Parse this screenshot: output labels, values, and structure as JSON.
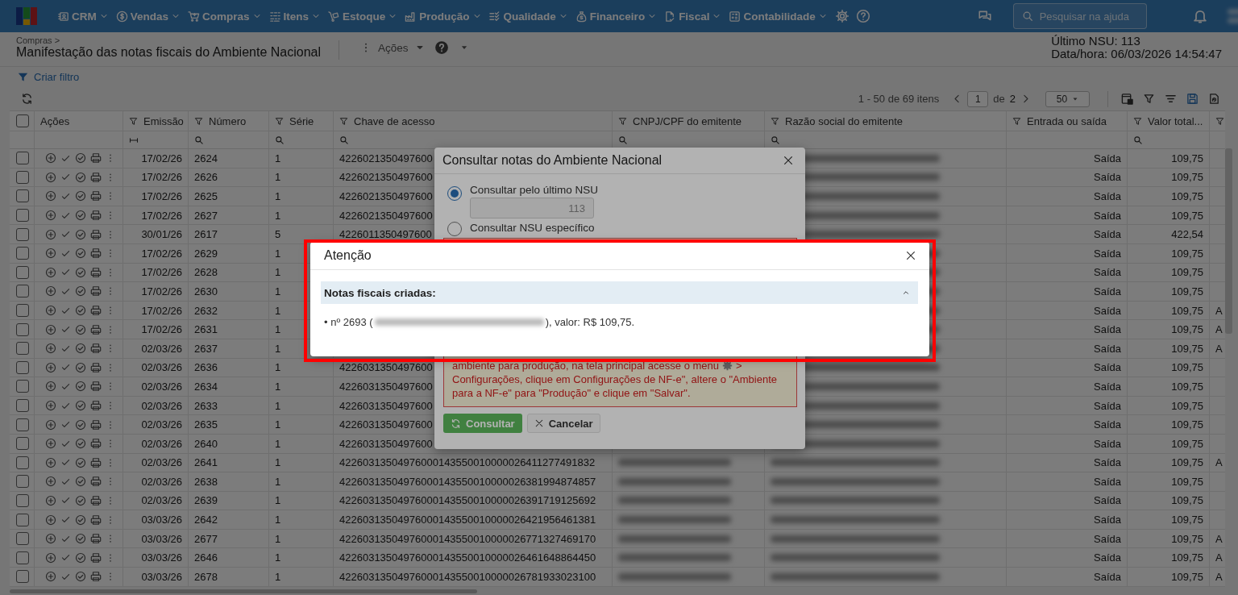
{
  "nav": {
    "items": [
      {
        "label": "CRM"
      },
      {
        "label": "Vendas"
      },
      {
        "label": "Compras"
      },
      {
        "label": "Itens"
      },
      {
        "label": "Estoque"
      },
      {
        "label": "Produção"
      },
      {
        "label": "Qualidade"
      },
      {
        "label": "Financeiro"
      },
      {
        "label": "Fiscal"
      },
      {
        "label": "Contabilidade"
      }
    ],
    "search": {
      "placeholder": "Pesquisar na ajuda"
    }
  },
  "page": {
    "breadcrumb": "Compras >",
    "title": "Manifestação das notas fiscais do Ambiente Nacional",
    "actions_menu": "Ações",
    "last_nsu": "Último NSU: 113",
    "datetime": "Data/hora: 06/03/2026 14:54:47",
    "filter_link": "Criar filtro"
  },
  "pagination": {
    "range": "1 - 50 de 69 itens",
    "page": "1",
    "of": "de",
    "pages": "2",
    "page_size": "50"
  },
  "table": {
    "all_selected": false,
    "columns": [
      {
        "label": "Ações",
        "filter": false,
        "search": false
      },
      {
        "label": "Emissão",
        "filter": true,
        "search": true,
        "kind": "date"
      },
      {
        "label": "Número",
        "filter": true,
        "search": true,
        "kind": "text"
      },
      {
        "label": "Série",
        "filter": true,
        "search": true,
        "kind": "text"
      },
      {
        "label": "Chave de acesso",
        "filter": true,
        "search": true,
        "kind": "text"
      },
      {
        "label": "CNPJ/CPF do emitente",
        "filter": true,
        "search": true,
        "kind": "text"
      },
      {
        "label": "Razão social do emitente",
        "filter": true,
        "search": true,
        "kind": "text"
      },
      {
        "label": "Entrada ou saída",
        "filter": true,
        "search": false
      },
      {
        "label": "Valor total...",
        "filter": true,
        "search": true,
        "kind": "text"
      },
      {
        "filter": true,
        "search": false
      }
    ],
    "rows": [
      {
        "selected": false,
        "emissao": "17/02/26",
        "numero": "2624",
        "serie": "1",
        "chave": "4226021350497600",
        "entrada": "Saída",
        "valor": "109,75"
      },
      {
        "selected": false,
        "emissao": "17/02/26",
        "numero": "2626",
        "serie": "1",
        "chave": "4226021350497600",
        "entrada": "Saída",
        "valor": "109,75"
      },
      {
        "selected": false,
        "emissao": "17/02/26",
        "numero": "2625",
        "serie": "1",
        "chave": "4226021350497600",
        "entrada": "Saída",
        "valor": "109,75"
      },
      {
        "selected": false,
        "emissao": "17/02/26",
        "numero": "2627",
        "serie": "1",
        "chave": "4226021350497600",
        "entrada": "Saída",
        "valor": "109,75"
      },
      {
        "selected": false,
        "emissao": "30/01/26",
        "numero": "2617",
        "serie": "5",
        "chave": "4226011350497600",
        "entrada": "Saída",
        "valor": "422,54"
      },
      {
        "selected": false,
        "emissao": "17/02/26",
        "numero": "2629",
        "serie": "1",
        "entrada": "Saída",
        "valor": "109,75"
      },
      {
        "selected": false,
        "emissao": "17/02/26",
        "numero": "2628",
        "serie": "1",
        "entrada": "Saída",
        "valor": "109,75"
      },
      {
        "selected": false,
        "emissao": "17/02/26",
        "numero": "2630",
        "serie": "1",
        "entrada": "Saída",
        "valor": "109,75"
      },
      {
        "selected": false,
        "emissao": "17/02/26",
        "numero": "2632",
        "serie": "1",
        "entrada": "Saída",
        "valor": "109,75",
        "column_11": "A"
      },
      {
        "selected": false,
        "emissao": "17/02/26",
        "numero": "2631",
        "serie": "1",
        "entrada": "Saída",
        "valor": "109,75",
        "column_11": "A"
      },
      {
        "selected": false,
        "emissao": "02/03/26",
        "numero": "2637",
        "serie": "1",
        "entrada": "Saída",
        "valor": "109,75",
        "column_11": "A"
      },
      {
        "selected": false,
        "emissao": "02/03/26",
        "numero": "2636",
        "serie": "1",
        "chave": "4226031350497600",
        "entrada": "Saída",
        "valor": "109,75"
      },
      {
        "selected": false,
        "emissao": "02/03/26",
        "numero": "2634",
        "serie": "1",
        "chave": "4226031350497600",
        "entrada": "Saída",
        "valor": "109,75"
      },
      {
        "selected": false,
        "emissao": "02/03/26",
        "numero": "2633",
        "serie": "1",
        "chave": "4226031350497600",
        "entrada": "Saída",
        "valor": "109,75"
      },
      {
        "selected": false,
        "emissao": "02/03/26",
        "numero": "2635",
        "serie": "1",
        "chave": "4226031350497600",
        "entrada": "Saída",
        "valor": "109,75"
      },
      {
        "selected": false,
        "emissao": "02/03/26",
        "numero": "2640",
        "serie": "1",
        "chave": "4226031350497600",
        "entrada": "Saída",
        "valor": "109,75"
      },
      {
        "selected": false,
        "emissao": "02/03/26",
        "numero": "2641",
        "serie": "1",
        "chave": "42260313504976000143550010000026411277491832",
        "entrada": "Saída",
        "valor": "109,75",
        "column_11": "A"
      },
      {
        "selected": false,
        "emissao": "02/03/26",
        "numero": "2638",
        "serie": "1",
        "chave": "42260313504976000143550010000026381994874857",
        "entrada": "Saída",
        "valor": "109,75"
      },
      {
        "selected": false,
        "emissao": "02/03/26",
        "numero": "2639",
        "serie": "1",
        "chave": "42260313504976000143550010000026391719125692",
        "entrada": "Saída",
        "valor": "109,75"
      },
      {
        "selected": false,
        "emissao": "03/03/26",
        "numero": "2642",
        "serie": "1",
        "chave": "42260313504976000143550010000026421956461381",
        "entrada": "Saída",
        "valor": "109,75"
      },
      {
        "selected": false,
        "emissao": "03/03/26",
        "numero": "2677",
        "serie": "1",
        "chave": "42260313504976000143550010000026771327469170",
        "entrada": "Saída",
        "valor": "109,75",
        "column_11": "A"
      },
      {
        "selected": false,
        "emissao": "03/03/26",
        "numero": "2646",
        "serie": "1",
        "chave": "42260313504976000143550010000026461648864450",
        "entrada": "Saída",
        "valor": "109,75",
        "column_11": "A"
      },
      {
        "selected": false,
        "emissao": "03/03/26",
        "numero": "2678",
        "serie": "1",
        "chave": "42260313504976000143550010000026781933023100",
        "entrada": "Saída",
        "valor": "109,75",
        "column_11": "A"
      }
    ]
  },
  "consult_dialog": {
    "title": "Consultar notas do Ambiente Nacional",
    "options": [
      {
        "label": "Consultar pelo último NSU",
        "selected": true,
        "value": "113"
      },
      {
        "label": "Consultar NSU específico",
        "selected": false
      }
    ],
    "warning": [
      "ambiente para produção, na tela principal acesse o menu",
      ">",
      "Configurações, clique em Configurações de NF-e\", altere o \"Ambiente para a NF-e\" para \"Produção\" e clique em \"Salvar\"."
    ],
    "buttons": [
      {
        "label": "Consultar",
        "kind": "primary"
      },
      {
        "label": "Cancelar",
        "kind": "secondary"
      }
    ]
  },
  "alert_dialog": {
    "title": "Atenção",
    "highlighted": true,
    "section": {
      "title": "Notas fiscais criadas:",
      "expanded": true,
      "items": [
        {
          "before": "• nº 2693 (",
          "after": "), valor: R$ 109,75."
        }
      ]
    }
  }
}
